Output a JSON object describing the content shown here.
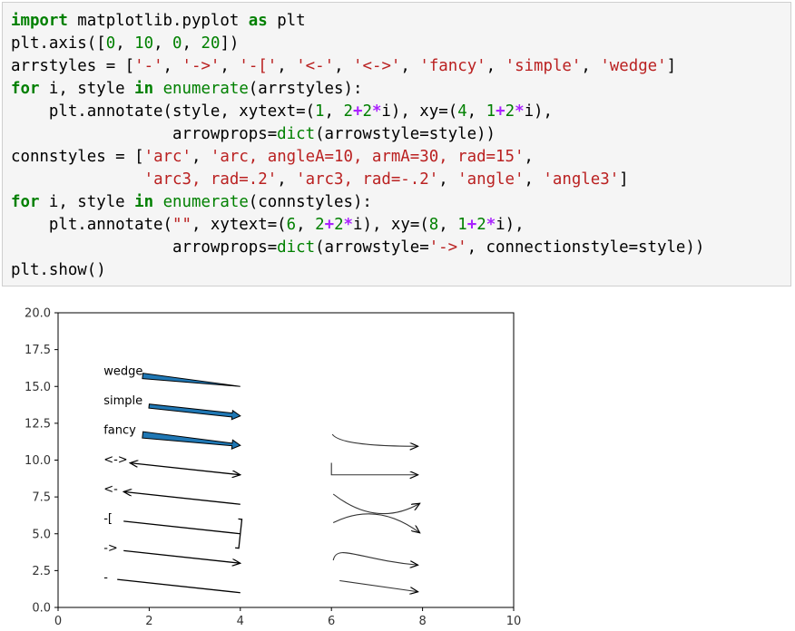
{
  "code": {
    "lines": [
      [
        [
          "kw",
          "import"
        ],
        [
          "pl",
          " matplotlib.pyplot "
        ],
        [
          "kw",
          "as"
        ],
        [
          "pl",
          " plt"
        ]
      ],
      [
        [
          "pl",
          "plt.axis(["
        ],
        [
          "nu",
          "0"
        ],
        [
          "pl",
          ", "
        ],
        [
          "nu",
          "10"
        ],
        [
          "pl",
          ", "
        ],
        [
          "nu",
          "0"
        ],
        [
          "pl",
          ", "
        ],
        [
          "nu",
          "20"
        ],
        [
          "pl",
          "])"
        ]
      ],
      [
        [
          "pl",
          "arrstyles = ["
        ],
        [
          "st",
          "'-'"
        ],
        [
          "pl",
          ", "
        ],
        [
          "st",
          "'->'"
        ],
        [
          "pl",
          ", "
        ],
        [
          "st",
          "'-['"
        ],
        [
          "pl",
          ", "
        ],
        [
          "st",
          "'<-'"
        ],
        [
          "pl",
          ", "
        ],
        [
          "st",
          "'<->'"
        ],
        [
          "pl",
          ", "
        ],
        [
          "st",
          "'fancy'"
        ],
        [
          "pl",
          ", "
        ],
        [
          "st",
          "'simple'"
        ],
        [
          "pl",
          ", "
        ],
        [
          "st",
          "'wedge'"
        ],
        [
          "pl",
          "]"
        ]
      ],
      [
        [
          "kw",
          "for"
        ],
        [
          "pl",
          " i, style "
        ],
        [
          "kw",
          "in"
        ],
        [
          "pl",
          " "
        ],
        [
          "bi",
          "enumerate"
        ],
        [
          "pl",
          "(arrstyles):"
        ]
      ],
      [
        [
          "pl",
          "    plt.annotate(style, xytext=("
        ],
        [
          "nu",
          "1"
        ],
        [
          "pl",
          ", "
        ],
        [
          "nu",
          "2"
        ],
        [
          "op",
          "+"
        ],
        [
          "nu",
          "2"
        ],
        [
          "op",
          "*"
        ],
        [
          "pl",
          "i), xy=("
        ],
        [
          "nu",
          "4"
        ],
        [
          "pl",
          ", "
        ],
        [
          "nu",
          "1"
        ],
        [
          "op",
          "+"
        ],
        [
          "nu",
          "2"
        ],
        [
          "op",
          "*"
        ],
        [
          "pl",
          "i),"
        ]
      ],
      [
        [
          "pl",
          "                 arrowprops="
        ],
        [
          "bi",
          "dict"
        ],
        [
          "pl",
          "(arrowstyle=style))"
        ]
      ],
      [
        [
          "pl",
          "connstyles = ["
        ],
        [
          "st",
          "'arc'"
        ],
        [
          "pl",
          ", "
        ],
        [
          "st",
          "'arc, angleA=10, armA=30, rad=15'"
        ],
        [
          "pl",
          ","
        ]
      ],
      [
        [
          "pl",
          "              "
        ],
        [
          "st",
          "'arc3, rad=.2'"
        ],
        [
          "pl",
          ", "
        ],
        [
          "st",
          "'arc3, rad=-.2'"
        ],
        [
          "pl",
          ", "
        ],
        [
          "st",
          "'angle'"
        ],
        [
          "pl",
          ", "
        ],
        [
          "st",
          "'angle3'"
        ],
        [
          "pl",
          "]"
        ]
      ],
      [
        [
          "kw",
          "for"
        ],
        [
          "pl",
          " i, style "
        ],
        [
          "kw",
          "in"
        ],
        [
          "pl",
          " "
        ],
        [
          "bi",
          "enumerate"
        ],
        [
          "pl",
          "(connstyles):"
        ]
      ],
      [
        [
          "pl",
          "    plt.annotate("
        ],
        [
          "st",
          "\"\""
        ],
        [
          "pl",
          ", xytext=("
        ],
        [
          "nu",
          "6"
        ],
        [
          "pl",
          ", "
        ],
        [
          "nu",
          "2"
        ],
        [
          "op",
          "+"
        ],
        [
          "nu",
          "2"
        ],
        [
          "op",
          "*"
        ],
        [
          "pl",
          "i), xy=("
        ],
        [
          "nu",
          "8"
        ],
        [
          "pl",
          ", "
        ],
        [
          "nu",
          "1"
        ],
        [
          "op",
          "+"
        ],
        [
          "nu",
          "2"
        ],
        [
          "op",
          "*"
        ],
        [
          "pl",
          "i),"
        ]
      ],
      [
        [
          "pl",
          "                 arrowprops="
        ],
        [
          "bi",
          "dict"
        ],
        [
          "pl",
          "(arrowstyle="
        ],
        [
          "st",
          "'->'"
        ],
        [
          "pl",
          ", connectionstyle=style))"
        ]
      ],
      [
        [
          "pl",
          "plt.show()"
        ]
      ]
    ]
  },
  "colors": {
    "fill": "#1f77b4",
    "stroke": "#000000",
    "axis": "#000000",
    "code_bg": "#f5f5f5"
  },
  "chart_data": {
    "type": "annotation",
    "xlim": [
      0,
      10
    ],
    "ylim": [
      0,
      20
    ],
    "xticks": [
      0,
      2,
      4,
      6,
      8,
      10
    ],
    "yticks": [
      0.0,
      2.5,
      5.0,
      7.5,
      10.0,
      12.5,
      15.0,
      17.5,
      20.0
    ],
    "xticklabels": [
      "0",
      "2",
      "4",
      "6",
      "8",
      "10"
    ],
    "yticklabels": [
      "0.0",
      "2.5",
      "5.0",
      "7.5",
      "10.0",
      "12.5",
      "15.0",
      "17.5",
      "20.0"
    ],
    "grid": false,
    "arrow_annotations": [
      {
        "label": "-",
        "style": "-",
        "xytext": [
          1,
          2
        ],
        "xy": [
          4,
          1
        ]
      },
      {
        "label": "->",
        "style": "->",
        "xytext": [
          1,
          4
        ],
        "xy": [
          4,
          3
        ]
      },
      {
        "label": "-[",
        "style": "-[",
        "xytext": [
          1,
          6
        ],
        "xy": [
          4,
          5
        ]
      },
      {
        "label": "<-",
        "style": "<-",
        "xytext": [
          1,
          8
        ],
        "xy": [
          4,
          7
        ]
      },
      {
        "label": "<->",
        "style": "<->",
        "xytext": [
          1,
          10
        ],
        "xy": [
          4,
          9
        ]
      },
      {
        "label": "fancy",
        "style": "fancy",
        "xytext": [
          1,
          12
        ],
        "xy": [
          4,
          11
        ]
      },
      {
        "label": "simple",
        "style": "simple",
        "xytext": [
          1,
          14
        ],
        "xy": [
          4,
          13
        ]
      },
      {
        "label": "wedge",
        "style": "wedge",
        "xytext": [
          1,
          16
        ],
        "xy": [
          4,
          15
        ]
      }
    ],
    "connection_annotations": [
      {
        "connectionstyle": "arc",
        "xytext": [
          6,
          2
        ],
        "xy": [
          8,
          1
        ]
      },
      {
        "connectionstyle": "arc, angleA=10, armA=30, rad=15",
        "xytext": [
          6,
          4
        ],
        "xy": [
          8,
          3
        ]
      },
      {
        "connectionstyle": "arc3, rad=.2",
        "xytext": [
          6,
          6
        ],
        "xy": [
          8,
          5
        ]
      },
      {
        "connectionstyle": "arc3, rad=-.2",
        "xytext": [
          6,
          8
        ],
        "xy": [
          8,
          7
        ]
      },
      {
        "connectionstyle": "angle",
        "xytext": [
          6,
          10
        ],
        "xy": [
          8,
          9
        ]
      },
      {
        "connectionstyle": "angle3",
        "xytext": [
          6,
          12
        ],
        "xy": [
          8,
          11
        ]
      }
    ]
  }
}
